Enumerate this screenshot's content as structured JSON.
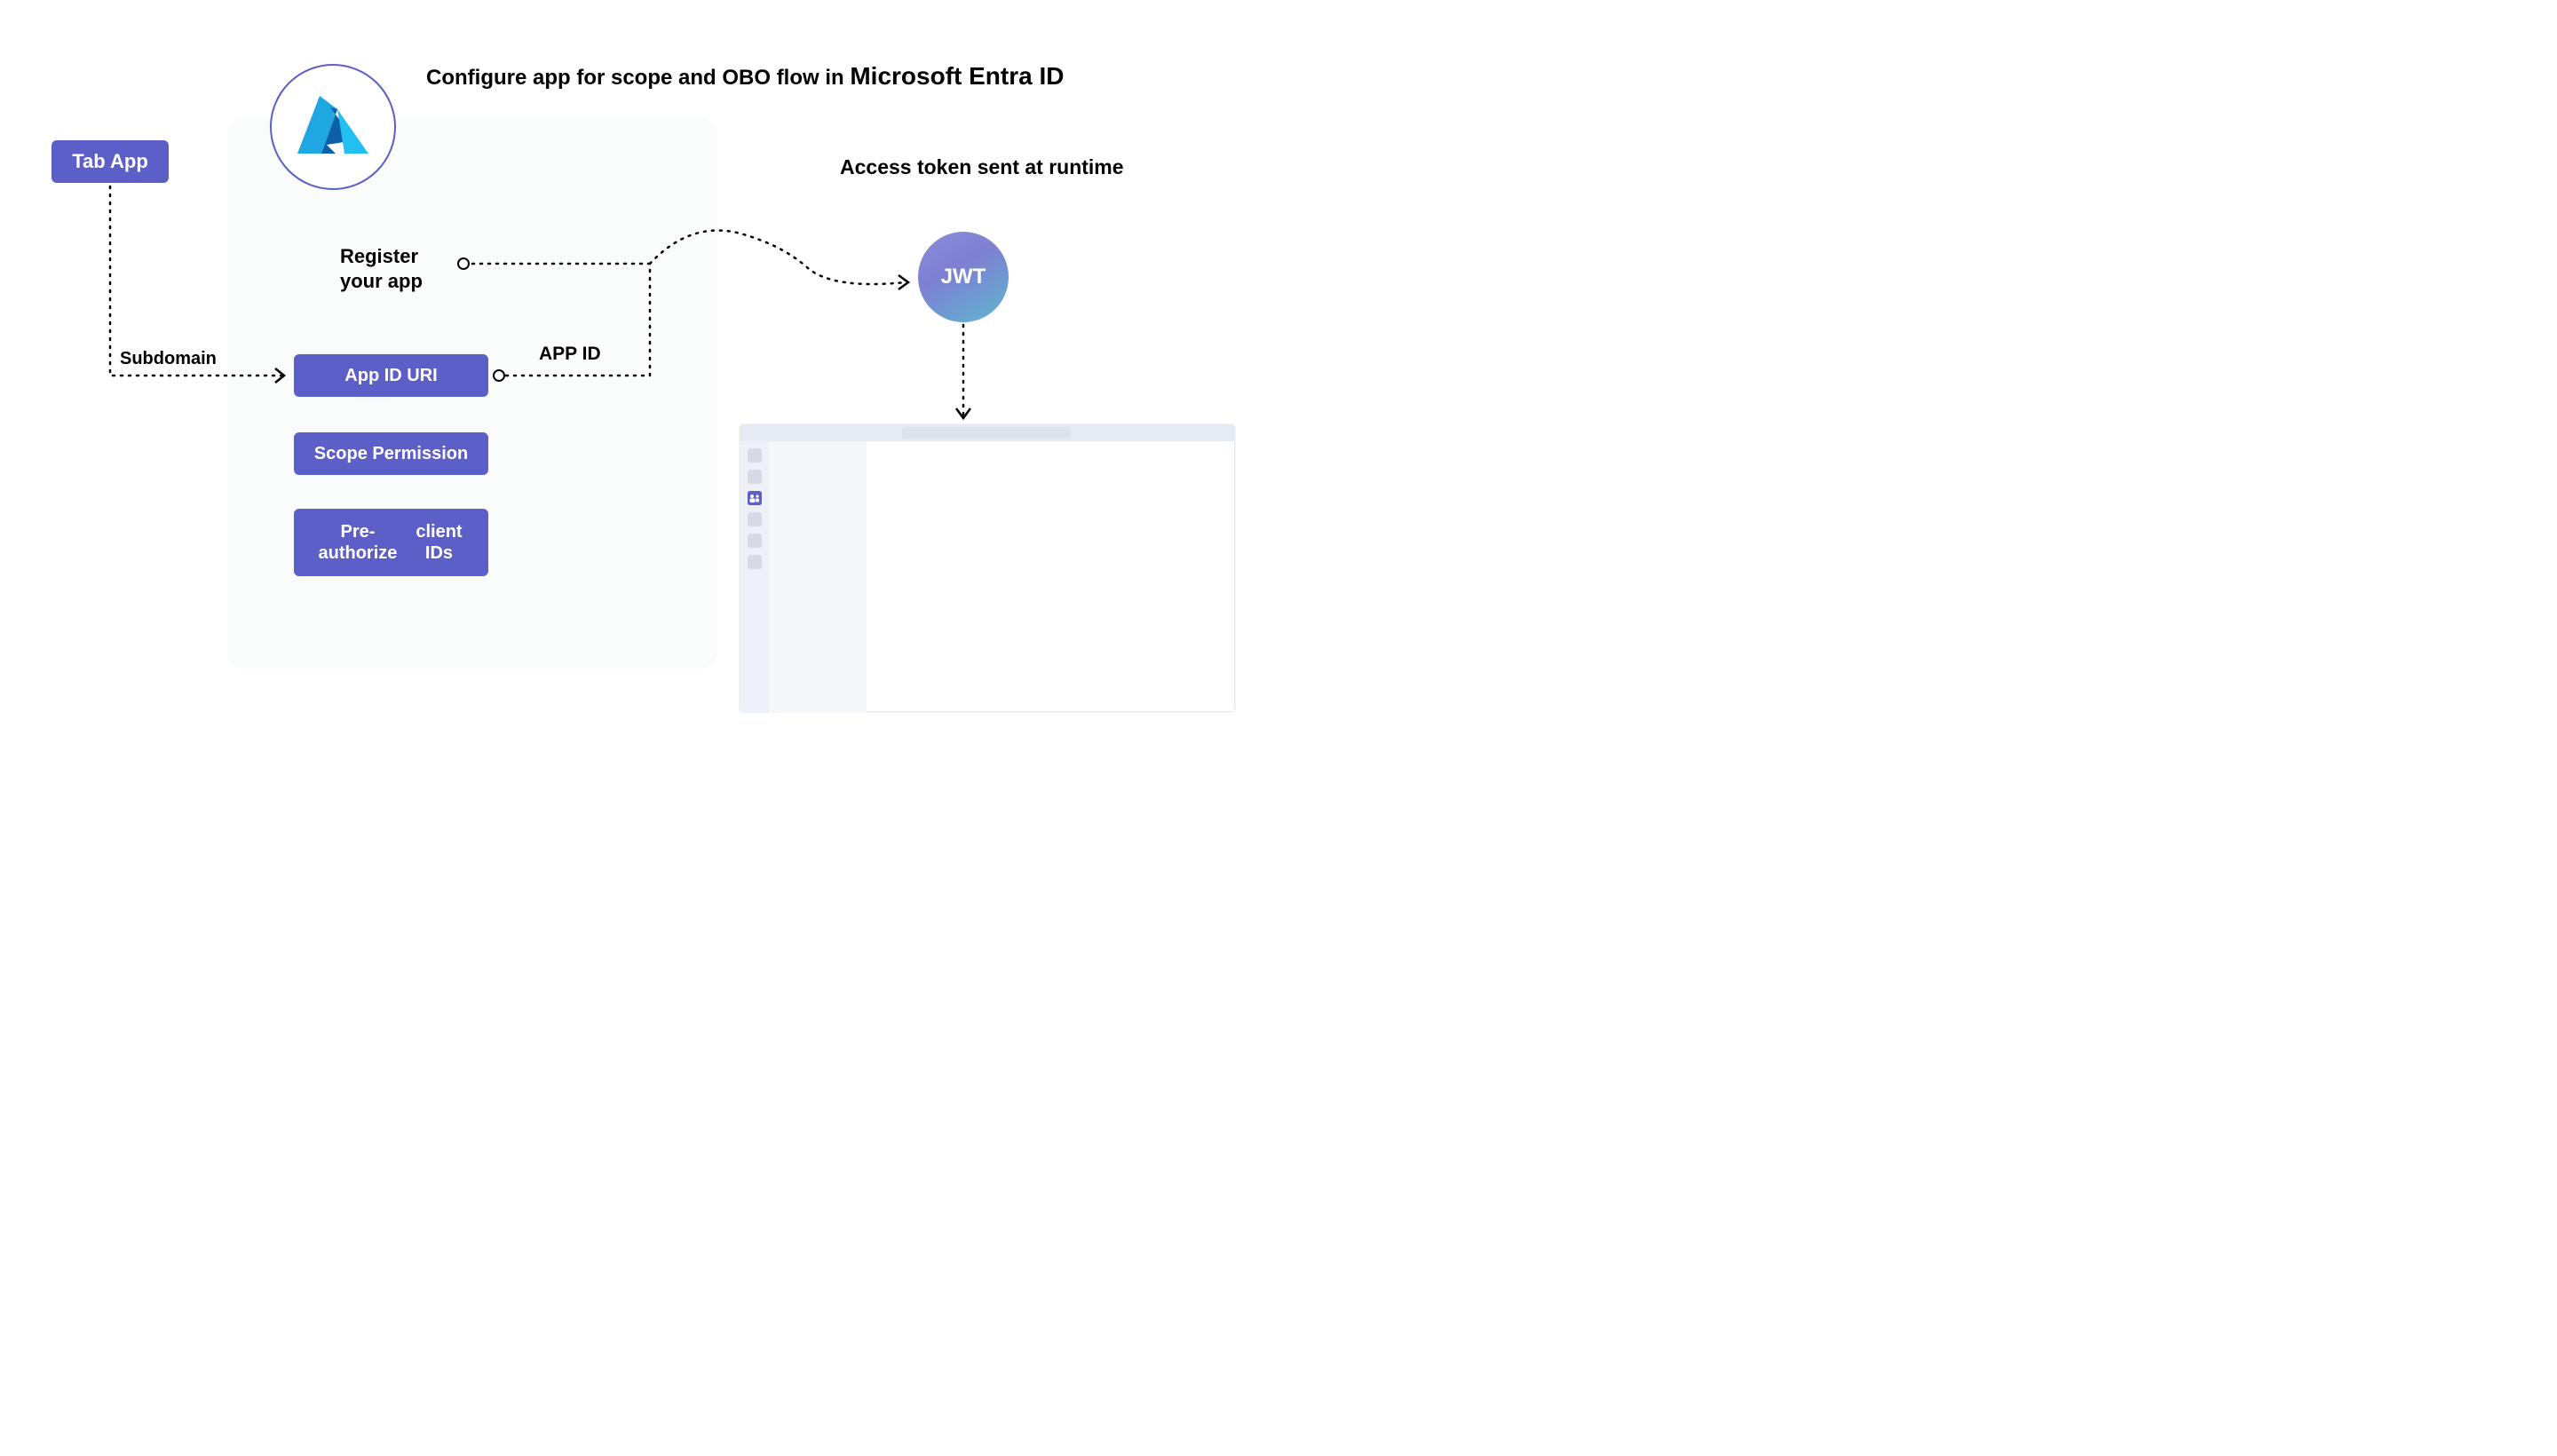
{
  "title": {
    "prefix": "Configure app for scope and OBO flow in ",
    "emphasis": "Microsoft Entra ID"
  },
  "tab_app_label": "Tab App",
  "register_label_l1": "Register",
  "register_label_l2": "your app",
  "subdomain_label": "Subdomain",
  "app_id_label": "APP ID",
  "steps": {
    "app_id_uri": "App ID URI",
    "scope_permission": "Scope Permission",
    "preauth_l1": "Pre-authorize",
    "preauth_l2": "client IDs"
  },
  "access_token_label": "Access token sent at runtime",
  "jwt_label": "JWT",
  "colors": {
    "primary": "#5b5fc7"
  }
}
